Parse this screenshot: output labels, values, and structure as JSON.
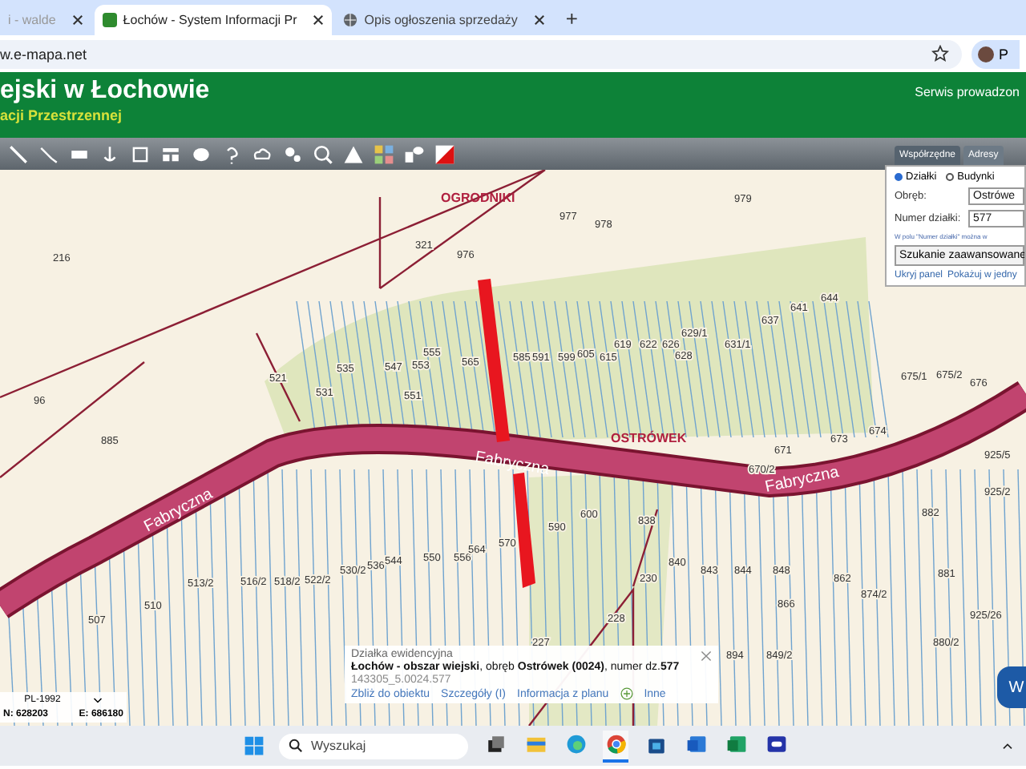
{
  "browser": {
    "tabs": [
      {
        "title": "i - walde",
        "selected": false
      },
      {
        "title": "Łochów - System Informacji Pr",
        "selected": true
      },
      {
        "title": "Opis ogłoszenia sprzedaży",
        "selected": false
      }
    ],
    "new_tab": "+",
    "address": "w.e-mapa.net",
    "profile": "P"
  },
  "header": {
    "title": "ejski w Łochowie",
    "subtitle": "acji Przestrzennej",
    "note": "Serwis prowadzon"
  },
  "map": {
    "place_labels": [
      "OGRODNIKI",
      "OSTRÓWEK"
    ],
    "street_labels": [
      "Fabryczna",
      "Fabryczna",
      "Fabryczna"
    ],
    "parcel_labels": [
      "216",
      "96",
      "885",
      "321",
      "976",
      "977",
      "978",
      "979",
      "535",
      "547",
      "553",
      "555",
      "565",
      "521",
      "531",
      "551",
      "585",
      "591",
      "599",
      "605",
      "615",
      "619",
      "622",
      "626",
      "628",
      "629/1",
      "631/1",
      "637",
      "641",
      "644",
      "675/1",
      "675/2",
      "676",
      "673",
      "674",
      "671",
      "670/2",
      "925/5",
      "925/2",
      "882",
      "838",
      "840",
      "843",
      "844",
      "848",
      "862",
      "874/2",
      "866",
      "881",
      "925/26",
      "507",
      "510",
      "513/2",
      "516/2",
      "518/2",
      "522/2",
      "530/2",
      "536",
      "544",
      "550",
      "556",
      "564",
      "570",
      "590",
      "600",
      "230",
      "228",
      "227",
      "894",
      "849/2",
      "880/2"
    ]
  },
  "panel": {
    "tabs": [
      {
        "label": "Współrzędne",
        "selected": true
      },
      {
        "label": "Adresy",
        "selected": false
      }
    ],
    "radios": [
      {
        "label": "Działki",
        "selected": true
      },
      {
        "label": "Budynki",
        "selected": false
      }
    ],
    "obreb_label": "Obręb:",
    "obreb_value": "Ostrówe",
    "number_label": "Numer działki:",
    "number_value": "577",
    "hint": "W polu \"Numer działki\" można w",
    "advanced_button": "Szukanie zaawansowane",
    "links": [
      "Ukryj panel",
      "Pokażuj w jedny"
    ]
  },
  "popup": {
    "heading": "Działka ewidencyjna",
    "description": "**Łochów - obszar wiejski**, obręb **Ostrówek (0024)**, numer dz.**577**",
    "identifier": "143305_5.0024.577",
    "links": [
      "Zbliż do obiektu",
      "Szczegóły (I)",
      "Informacja z planu"
    ],
    "more": "Inne"
  },
  "coords": {
    "system": "PL-1992",
    "north": "N: 628203",
    "east": "E: 686180"
  },
  "side_button": "W",
  "taskbar": {
    "search_placeholder": "Wyszukaj",
    "apps": [
      {
        "kind": "taskview",
        "active": false
      },
      {
        "kind": "explorer",
        "active": false
      },
      {
        "kind": "edge",
        "active": false
      },
      {
        "kind": "chrome",
        "active": true
      },
      {
        "kind": "store",
        "active": false
      },
      {
        "kind": "word",
        "active": false
      },
      {
        "kind": "excel",
        "active": false
      },
      {
        "kind": "meet",
        "active": false
      }
    ]
  }
}
